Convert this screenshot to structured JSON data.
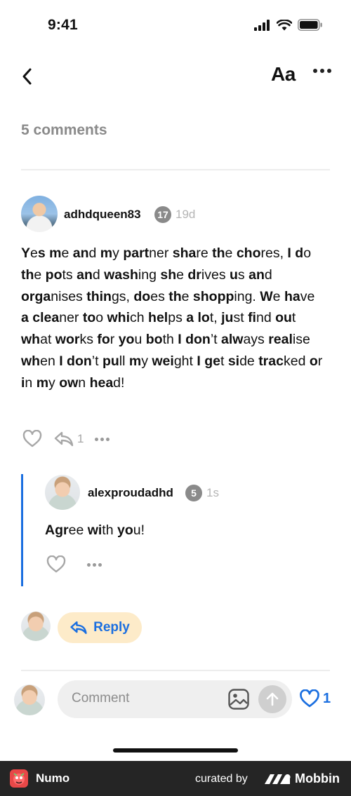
{
  "status_bar": {
    "time": "9:41"
  },
  "header": {
    "text_size_label": "Aa"
  },
  "comments": {
    "count_label": "5 comments"
  },
  "comment": {
    "username": "adhdqueen83",
    "level": "17",
    "time": "19d",
    "body_html": "<b>Y</b>e<b>s</b> <b>m</b>e <b>an</b>d <b>m</b>y <b>part</b>ner <b>sha</b>re <b>th</b>e <b>cho</b>res, <b>I</b> <b>d</b>o <b>th</b>e <b>po</b>ts <b>an</b>d <b>wash</b>ing <b>sh</b>e <b>dr</b>ives <b>u</b>s <b>an</b>d <b>orga</b>nises <b>thin</b>gs, <b>do</b>es <b>th</b>e <b>shopp</b>ing. <b>W</b>e <b>ha</b>ve <b>a</b> <b>clea</b>ner <b>to</b>o <b>whi</b>ch <b>hel</b>ps <b>a</b> <b>lo</b>t, <b>ju</b>st <b>fi</b>nd <b>ou</b>t <b>wh</b>at <b>wor</b>ks <b>fo</b>r <b>yo</b>u <b>bo</b>th <b>I</b> <b>don</b>’t <b>alw</b>ays <b>real</b>ise <b>wh</b>en <b>I</b> <b>don</b>’t <b>pu</b>ll <b>m</b>y <b>wei</b>ght <b>I</b> <b>ge</b>t <b>si</b>de <b>trac</b>ked <b>o</b>r <b>i</b>n <b>m</b>y <b>ow</b>n <b>hea</b>d!",
    "reply_count": "1"
  },
  "reply": {
    "username": "alexproudadhd",
    "level": "5",
    "time": "1s",
    "body_html": "<b>Agr</b>ee <b>wi</b>th <b>yo</b>u!"
  },
  "reply_button": {
    "label": "Reply"
  },
  "composer": {
    "placeholder": "Comment",
    "like_count": "1"
  },
  "footer": {
    "app_name": "Numo",
    "curated_by": "curated by",
    "brand": "Mobbin"
  },
  "colors": {
    "accent": "#1b6fe0",
    "reply_bg": "#fdebc9",
    "muted": "#8a8a8a",
    "footer_bg": "#252525"
  }
}
